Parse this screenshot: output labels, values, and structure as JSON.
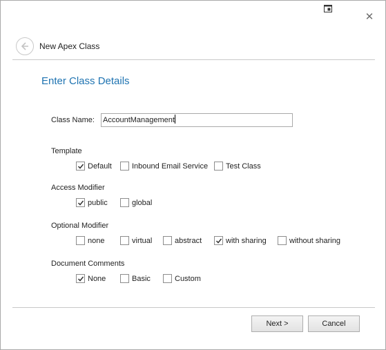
{
  "dialog": {
    "header_title": "New Apex Class",
    "page_title": "Enter Class Details"
  },
  "class_name": {
    "label": "Class Name:",
    "value": "AccountManagement"
  },
  "groups": {
    "template": {
      "label": "Template",
      "options": [
        {
          "label": "Default",
          "checked": true
        },
        {
          "label": "Inbound Email Service",
          "checked": false
        },
        {
          "label": "Test Class",
          "checked": false
        }
      ]
    },
    "access_modifier": {
      "label": "Access Modifier",
      "options": [
        {
          "label": "public",
          "checked": true
        },
        {
          "label": "global",
          "checked": false
        }
      ]
    },
    "optional_modifier": {
      "label": "Optional  Modifier",
      "options": [
        {
          "label": "none",
          "checked": false
        },
        {
          "label": "virtual",
          "checked": false
        },
        {
          "label": "abstract",
          "checked": false
        },
        {
          "label": "with sharing",
          "checked": true
        },
        {
          "label": "without sharing",
          "checked": false
        }
      ]
    },
    "document_comments": {
      "label": "Document Comments",
      "options": [
        {
          "label": "None",
          "checked": true
        },
        {
          "label": "Basic",
          "checked": false
        },
        {
          "label": "Custom",
          "checked": false
        }
      ]
    }
  },
  "buttons": {
    "next": "Next >",
    "cancel": "Cancel"
  },
  "colors": {
    "page_title": "#1e73b1",
    "rule": "#c8c8c8"
  },
  "icons": {
    "window": [
      "restore-icon",
      "close-icon"
    ],
    "header": "back-arrow-icon",
    "checkbox_checked": "checkmark-icon"
  }
}
